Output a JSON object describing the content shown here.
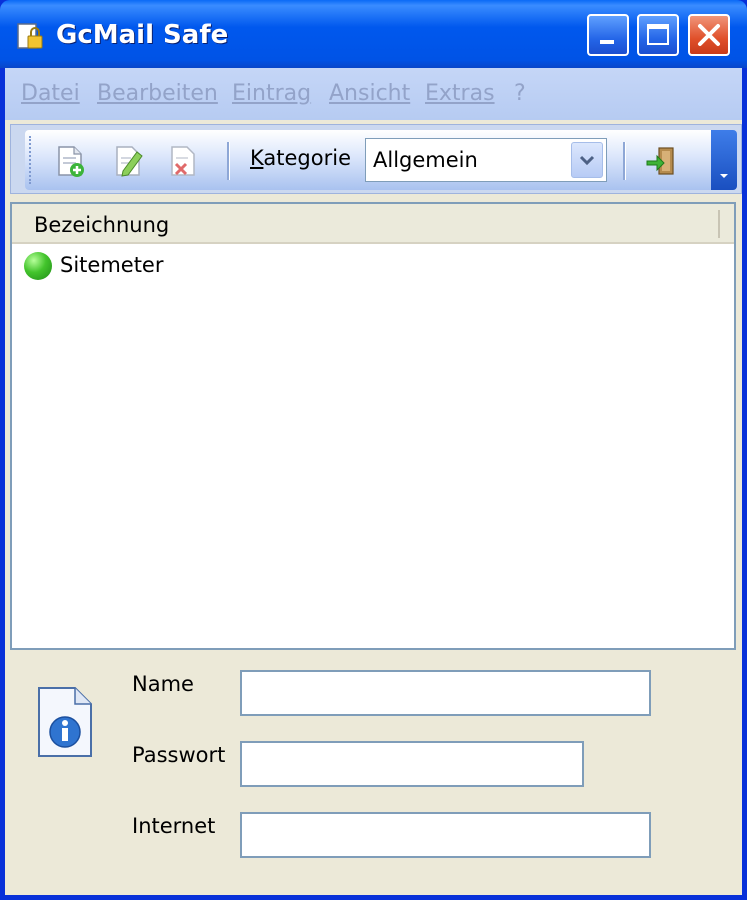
{
  "window": {
    "title": "GcMail Safe"
  },
  "menu": [
    "Datei",
    "Bearbeiten",
    "Eintrag",
    "Ansicht",
    "Extras",
    "?"
  ],
  "toolbar": {
    "kategorie_label_first": "K",
    "kategorie_label_rest": "ategorie",
    "kategorie_value": "Allgemein",
    "icons": [
      "new-entry-icon",
      "edit-entry-icon",
      "delete-entry-icon",
      "exit-icon"
    ]
  },
  "list": {
    "column_header": "Bezeichnung",
    "rows": [
      {
        "label": "Sitemeter",
        "status_color": "#3cbf28"
      }
    ]
  },
  "details": {
    "name_label": "Name",
    "name_value": "",
    "password_label": "Passwort",
    "password_value": "",
    "internet_label": "Internet",
    "internet_value": ""
  },
  "colors": {
    "titlebar": "#0054e3",
    "menubar": "#c1d3fb",
    "close_button": "#e0502a"
  }
}
